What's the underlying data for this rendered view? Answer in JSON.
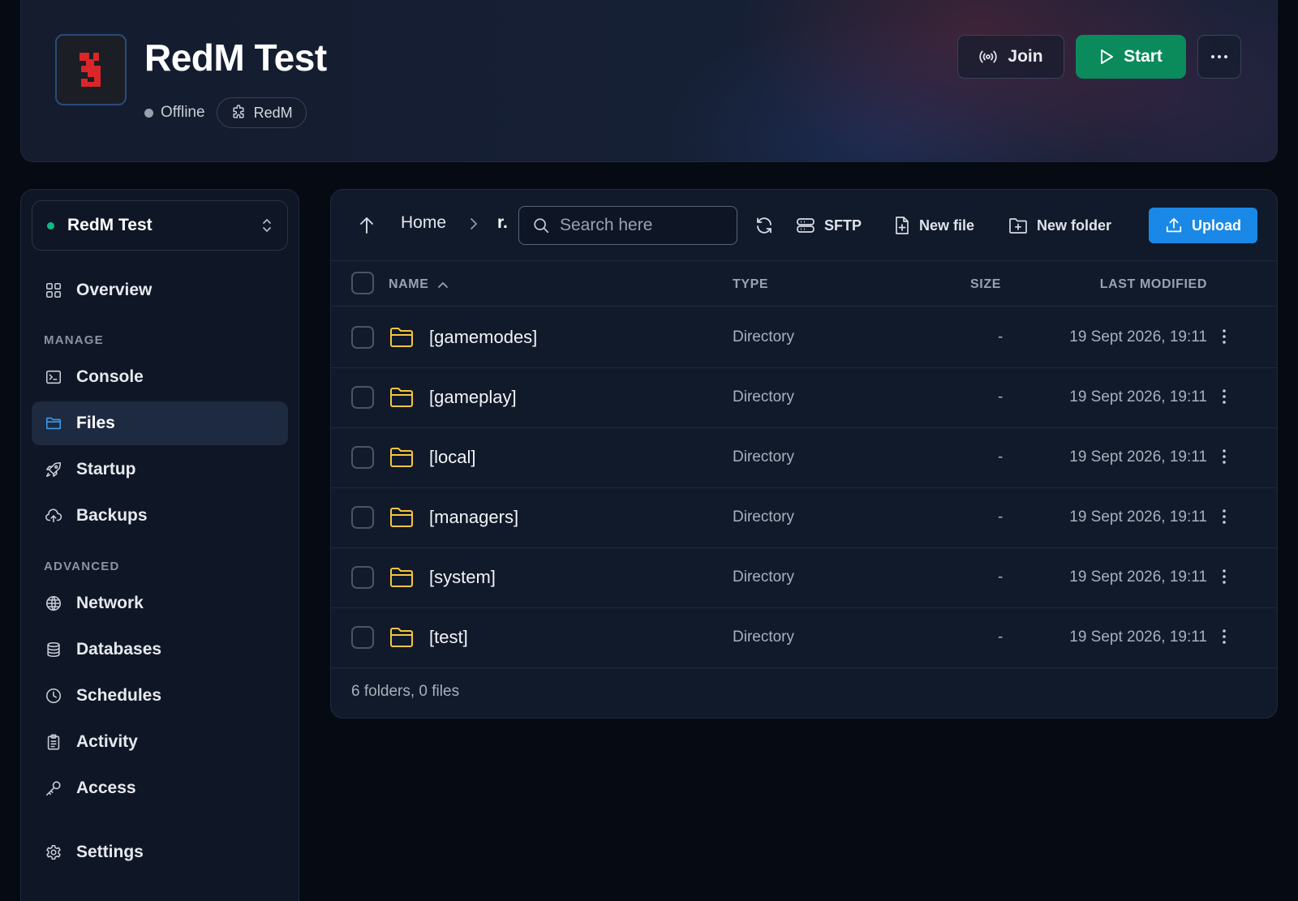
{
  "server": {
    "name": "RedM Test",
    "status": "Offline",
    "egg": "RedM"
  },
  "actions": {
    "join": "Join",
    "start": "Start"
  },
  "sidebar": {
    "selector_name": "RedM Test",
    "overview": "Overview",
    "manage_label": "MANAGE",
    "manage_items": [
      "Console",
      "Files",
      "Startup",
      "Backups"
    ],
    "advanced_label": "ADVANCED",
    "advanced_items": [
      "Network",
      "Databases",
      "Schedules",
      "Activity",
      "Access"
    ],
    "settings": "Settings",
    "active": "Files"
  },
  "files": {
    "breadcrumb_home": "Home",
    "breadcrumb_current": "r.",
    "search_placeholder": "Search here",
    "sftp": "SFTP",
    "new_file": "New file",
    "new_folder": "New folder",
    "upload": "Upload",
    "columns": {
      "name": "NAME",
      "type": "TYPE",
      "size": "SIZE",
      "modified": "LAST MODIFIED"
    },
    "rows": [
      {
        "name": "[gamemodes]",
        "type": "Directory",
        "size": "-",
        "modified": "19 Sept 2026, 19:11"
      },
      {
        "name": "[gameplay]",
        "type": "Directory",
        "size": "-",
        "modified": "19 Sept 2026, 19:11"
      },
      {
        "name": "[local]",
        "type": "Directory",
        "size": "-",
        "modified": "19 Sept 2026, 19:11"
      },
      {
        "name": "[managers]",
        "type": "Directory",
        "size": "-",
        "modified": "19 Sept 2026, 19:11"
      },
      {
        "name": "[system]",
        "type": "Directory",
        "size": "-",
        "modified": "19 Sept 2026, 19:11"
      },
      {
        "name": "[test]",
        "type": "Directory",
        "size": "-",
        "modified": "19 Sept 2026, 19:11"
      }
    ],
    "summary": "6 folders, 0 files"
  },
  "colors": {
    "start": "#0b8a5c",
    "upload": "#1a88e6",
    "folder": "#f5c542",
    "online_dot": "#10b981",
    "offline_dot": "#9aa1ad"
  },
  "icons": {
    "header": [
      "server-logo",
      "status-dot",
      "puzzle-icon",
      "broadcast-icon",
      "play-icon",
      "more-icon"
    ],
    "toolbar": [
      "arrow-up-icon",
      "chevron-right-icon",
      "search-icon",
      "refresh-icon",
      "sftp-drive-icon",
      "new-file-icon",
      "new-folder-icon",
      "upload-icon"
    ],
    "sidebar": [
      "overview-grid-icon",
      "console-icon",
      "folder-icon",
      "rocket-icon",
      "cloud-upload-icon",
      "globe-icon",
      "database-icon",
      "clock-icon",
      "clipboard-icon",
      "key-icon",
      "gear-icon"
    ]
  }
}
